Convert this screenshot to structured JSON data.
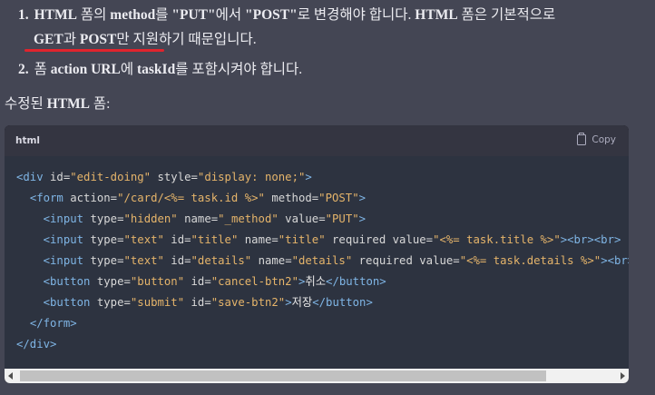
{
  "list_items": [
    {
      "number": "1.",
      "line1_parts": [
        "HTML",
        " 폼의 ",
        "method",
        "를 ",
        "\"PUT\"",
        "에서 ",
        "\"POST\"",
        "로 변경해야 합니다. ",
        "HTML",
        " 폼은 기본적으로"
      ],
      "line2_parts": [
        "GET",
        "과 ",
        "POST",
        "만 지원하기 때문입니다."
      ]
    },
    {
      "number": "2.",
      "line1_parts": [
        "폼 ",
        "action URL",
        "에 ",
        "taskId",
        "를 포함시켜야 합니다."
      ]
    }
  ],
  "subheading_parts": [
    "수정된 ",
    "HTML",
    " 폼:"
  ],
  "code_block": {
    "language": "html",
    "copy_label": "Copy",
    "lines": [
      [
        [
          "t",
          "<div "
        ],
        [
          "a",
          "id="
        ],
        [
          "s",
          "\"edit-doing\""
        ],
        [
          "a",
          " style="
        ],
        [
          "s",
          "\"display: none;\""
        ],
        [
          "t",
          ">"
        ]
      ],
      [
        [
          "w",
          "  "
        ],
        [
          "t",
          "<form "
        ],
        [
          "a",
          "action="
        ],
        [
          "s",
          "\"/card/<%= task.id %>\""
        ],
        [
          "a",
          " method="
        ],
        [
          "s",
          "\"POST\""
        ],
        [
          "t",
          ">"
        ]
      ],
      [
        [
          "w",
          "    "
        ],
        [
          "t",
          "<input "
        ],
        [
          "a",
          "type="
        ],
        [
          "s",
          "\"hidden\""
        ],
        [
          "a",
          " name="
        ],
        [
          "s",
          "\"_method\""
        ],
        [
          "a",
          " value="
        ],
        [
          "s",
          "\"PUT\""
        ],
        [
          "t",
          ">"
        ]
      ],
      [
        [
          "w",
          "    "
        ],
        [
          "t",
          "<input "
        ],
        [
          "a",
          "type="
        ],
        [
          "s",
          "\"text\""
        ],
        [
          "a",
          " id="
        ],
        [
          "s",
          "\"title\""
        ],
        [
          "a",
          " name="
        ],
        [
          "s",
          "\"title\""
        ],
        [
          "a",
          " required value="
        ],
        [
          "s",
          "\"<%= task.title %>\""
        ],
        [
          "t",
          ">"
        ],
        [
          "t",
          "<br>"
        ],
        [
          "t",
          "<br>"
        ]
      ],
      [
        [
          "w",
          "    "
        ],
        [
          "t",
          "<input "
        ],
        [
          "a",
          "type="
        ],
        [
          "s",
          "\"text\""
        ],
        [
          "a",
          " id="
        ],
        [
          "s",
          "\"details\""
        ],
        [
          "a",
          " name="
        ],
        [
          "s",
          "\"details\""
        ],
        [
          "a",
          " required value="
        ],
        [
          "s",
          "\"<%= task.details %>\""
        ],
        [
          "t",
          ">"
        ],
        [
          "t",
          "<br>"
        ]
      ],
      [
        [
          "w",
          "    "
        ],
        [
          "t",
          "<button "
        ],
        [
          "a",
          "type="
        ],
        [
          "s",
          "\"button\""
        ],
        [
          "a",
          " id="
        ],
        [
          "s",
          "\"cancel-btn2\""
        ],
        [
          "t",
          ">"
        ],
        [
          "w",
          "취소"
        ],
        [
          "t",
          "</button>"
        ]
      ],
      [
        [
          "w",
          "    "
        ],
        [
          "t",
          "<button "
        ],
        [
          "a",
          "type="
        ],
        [
          "s",
          "\"submit\""
        ],
        [
          "a",
          " id="
        ],
        [
          "s",
          "\"save-btn2\""
        ],
        [
          "t",
          ">"
        ],
        [
          "w",
          "저장"
        ],
        [
          "t",
          "</button>"
        ]
      ],
      [
        [
          "w",
          "  "
        ],
        [
          "t",
          "</form>"
        ]
      ],
      [
        [
          "t",
          "</div>"
        ]
      ]
    ]
  },
  "colors": {
    "background": "#444654",
    "code_body": "#2d3340",
    "tag": "#7fb5e5",
    "attr": "#d8d8d8",
    "string": "#e5b46a",
    "text": "#e6e6e6",
    "underline": "#e0242d"
  },
  "icons": {
    "copy": "clipboard-icon"
  }
}
